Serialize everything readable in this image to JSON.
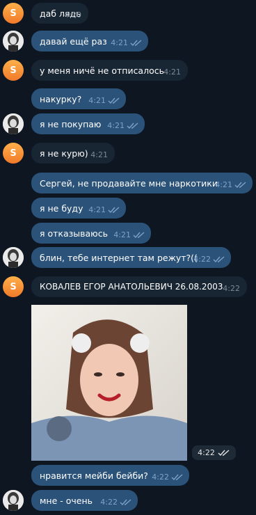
{
  "messages": [
    {
      "id": "m1",
      "text": "даб лядь",
      "time": "4:20",
      "direction": "in",
      "avatar": "S"
    },
    {
      "id": "m2",
      "text": "давай ещё раз",
      "time": "4:21",
      "direction": "out",
      "read": true
    },
    {
      "id": "m3",
      "text": "у меня ничё не отписалось",
      "time": "4:21",
      "direction": "in",
      "avatar": "S"
    },
    {
      "id": "m4",
      "text": "накурку?",
      "time": "4:21",
      "direction": "out",
      "read": true
    },
    {
      "id": "m5",
      "text": "я не покупаю",
      "time": "4:21",
      "direction": "out",
      "read": true
    },
    {
      "id": "m6",
      "text": "я не курю)",
      "time": "4:21",
      "direction": "in",
      "avatar": "S"
    },
    {
      "id": "m7",
      "text": "Сергей, не продавайте мне наркотики",
      "time": "4:21",
      "direction": "out",
      "read": true
    },
    {
      "id": "m8",
      "text": "я не буду",
      "time": "4:21",
      "direction": "out",
      "read": true
    },
    {
      "id": "m9",
      "text": "я отказываюсь",
      "time": "4:21",
      "direction": "out",
      "read": true
    },
    {
      "id": "m10",
      "text": "блин, тебе интернет там режут?((",
      "time": "4:22",
      "direction": "out",
      "read": true
    },
    {
      "id": "m11",
      "text": "КОВАЛЕВ ЕГОР АНАТОЛЬЕВИЧ 26.08.2003",
      "time": "4:22",
      "direction": "in",
      "avatar": "S"
    },
    {
      "id": "m12",
      "type": "photo",
      "time": "4:22",
      "direction": "out",
      "read": true
    },
    {
      "id": "m13",
      "text": "нравится мейби бейби?",
      "time": "4:22",
      "direction": "out",
      "read": true
    },
    {
      "id": "m14",
      "text": "мне - очень",
      "time": "4:22",
      "direction": "out",
      "read": true
    }
  ],
  "avatar_letter": "S",
  "colors": {
    "background": "#0e1621",
    "bubble_in": "#182533",
    "bubble_out": "#2b5278",
    "avatar": "#f58a2c",
    "read_tick": "#7da3c9"
  }
}
